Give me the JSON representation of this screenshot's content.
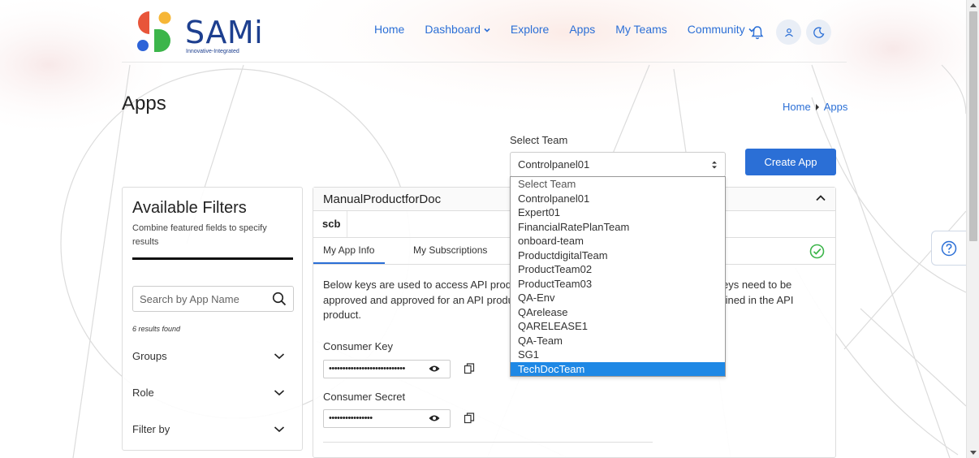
{
  "brand": {
    "name": "SAMi",
    "tagline": "Innovative-Integrated"
  },
  "nav": {
    "home": "Home",
    "dashboard": "Dashboard",
    "explore": "Explore",
    "apps": "Apps",
    "my_teams": "My Teams",
    "community": "Community"
  },
  "page": {
    "title": "Apps"
  },
  "breadcrumb": {
    "home": "Home",
    "current": "Apps"
  },
  "team_select": {
    "label": "Select Team",
    "value": "Controlpanel01",
    "options": [
      "Select Team",
      "Controlpanel01",
      "Expert01",
      "FinancialRatePlanTeam",
      "onboard-team",
      "ProductdigitalTeam",
      "ProductTeam02",
      "ProductTeam03",
      "QA-Env",
      "QArelease",
      "QARELEASE1",
      "QA-Team",
      "SG1",
      "TechDocTeam"
    ],
    "highlighted": "TechDocTeam"
  },
  "create_app": {
    "label": "Create App"
  },
  "filters": {
    "title": "Available Filters",
    "subtitle": "Combine featured fields to specify results",
    "search_placeholder": "Search by App Name",
    "results": "6 results found",
    "groups": "Groups",
    "role": "Role",
    "filter_by": "Filter by"
  },
  "app": {
    "name": "ManualProductforDoc",
    "org": "scb",
    "tabs": {
      "info": "My App Info",
      "subscriptions": "My Subscriptions"
    },
    "desc_line1_left": "Below keys are used to access API produ",
    "desc_line1_right": "eys need to be",
    "desc_line2_left": "approved and approved for an API produ",
    "desc_line2_right": "fined in the API",
    "desc_line3": "product.",
    "consumer_key_label": "Consumer Key",
    "consumer_key_value": "••••••••••••••••••••••••••••",
    "consumer_secret_label": "Consumer Secret",
    "consumer_secret_value": "••••••••••••••••"
  },
  "colors": {
    "primary": "#2b6fd6",
    "brand_navy": "#1d3f8f",
    "selected": "#1e88e5",
    "success": "#3cb54a"
  }
}
